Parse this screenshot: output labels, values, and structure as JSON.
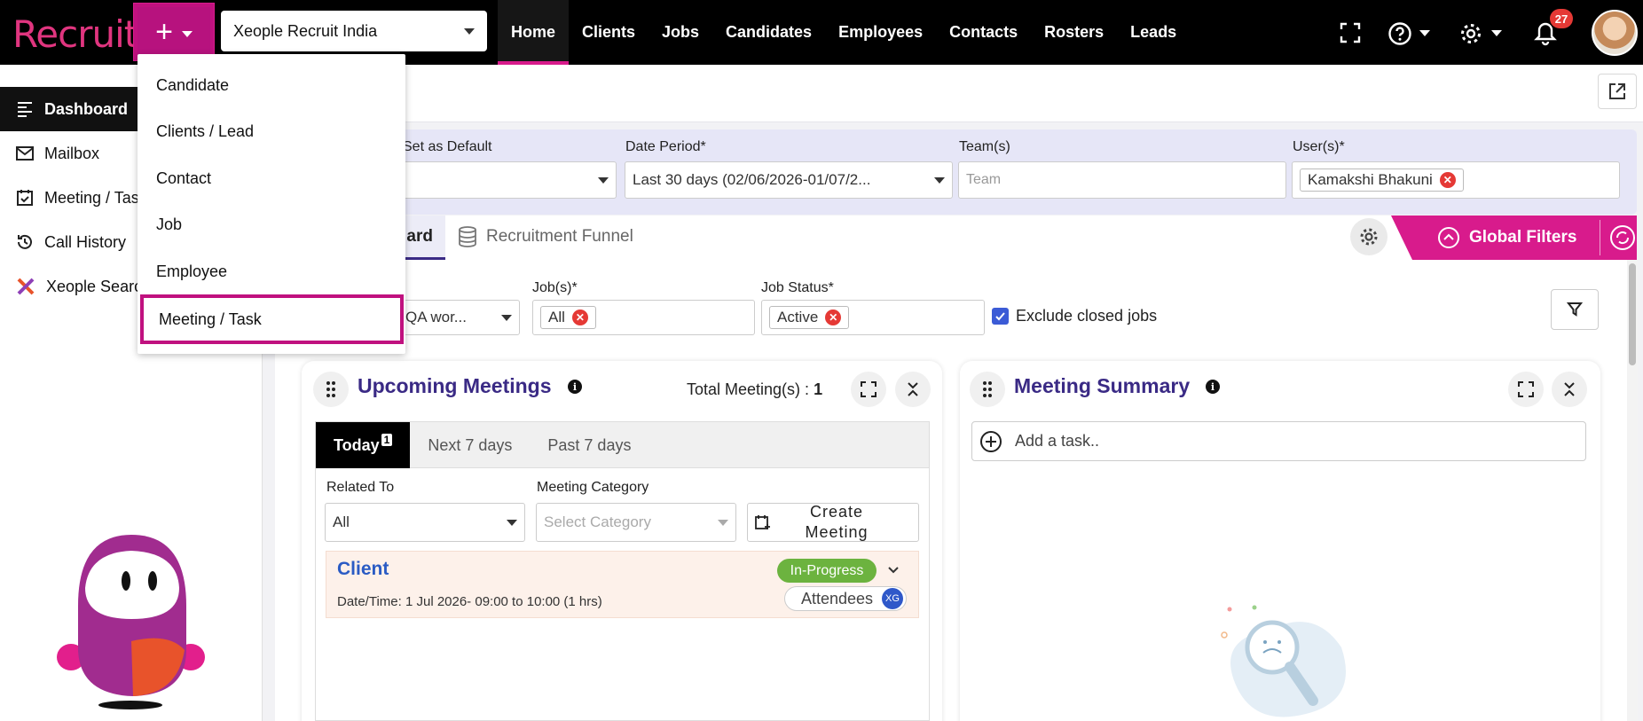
{
  "app": {
    "logo_text": "Recruit",
    "brand_color": "#d81b8c",
    "org_selector": "Xeople Recruit India",
    "notification_count": "27"
  },
  "nav": {
    "items": [
      {
        "label": "Home",
        "active": true
      },
      {
        "label": "Clients"
      },
      {
        "label": "Jobs"
      },
      {
        "label": "Candidates"
      },
      {
        "label": "Employees"
      },
      {
        "label": "Contacts"
      },
      {
        "label": "Rosters"
      },
      {
        "label": "Leads"
      }
    ]
  },
  "add_menu": {
    "items": [
      "Candidate",
      "Clients / Lead",
      "Contact",
      "Job",
      "Employee",
      "Meeting / Task"
    ],
    "highlighted": "Meeting / Task"
  },
  "sidebar": {
    "items": [
      {
        "label": "Dashboard",
        "icon": "dashboard-icon",
        "active": true
      },
      {
        "label": "Mailbox",
        "icon": "mail-icon"
      },
      {
        "label": "Meeting / Task",
        "icon": "calendar-check-icon"
      },
      {
        "label": "Call History",
        "icon": "history-icon"
      },
      {
        "label": "Xeople Search",
        "icon": "xeople-logo-icon"
      }
    ]
  },
  "filters": {
    "set_default_label": "Set as Default",
    "date_period_label": "Date Period*",
    "date_period_value": "Last 30 days (02/06/2026-01/07/2...",
    "teams_label": "Team(s)",
    "teams_placeholder": "Team",
    "users_label": "User(s)*",
    "users_chip": "Kamakshi Bhakuni"
  },
  "tabs": {
    "dashboard_partial": "ard",
    "funnel": "Recruitment Funnel",
    "global_filters": "Global Filters"
  },
  "job_filters": {
    "first_value": "QA wor...",
    "jobs_label": "Job(s)*",
    "jobs_chip": "All",
    "status_label": "Job Status*",
    "status_chip": "Active",
    "exclude_label": "Exclude closed jobs",
    "exclude_checked": true
  },
  "upcoming": {
    "title": "Upcoming Meetings",
    "total_label": "Total Meeting(s) :",
    "total_value": "1",
    "tabs": [
      "Today",
      "Next 7 days",
      "Past 7 days"
    ],
    "today_count": "1",
    "related_label": "Related To",
    "related_value": "All",
    "category_label": "Meeting Category",
    "category_placeholder": "Select Category",
    "create_label": "Create Meeting",
    "meeting": {
      "title": "Client",
      "status": "In-Progress",
      "status_color": "#6cb33f",
      "datetime": "Date/Time: 1 Jul 2026- 09:00 to 10:00 (1 hrs)",
      "attendees_label": "Attendees",
      "attendee_initials": "XG"
    }
  },
  "summary": {
    "title": "Meeting Summary",
    "add_task_placeholder": "Add a task.."
  }
}
